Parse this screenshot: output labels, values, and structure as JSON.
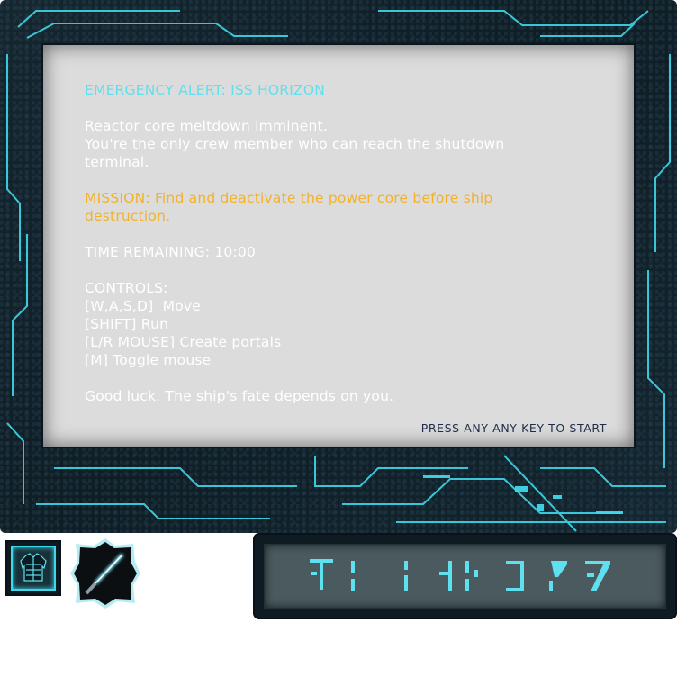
{
  "briefing": {
    "title": "EMERGENCY ALERT: ISS HORIZON",
    "line1": "Reactor core meltdown imminent.",
    "line2": "You're the only crew member who can reach the shutdown",
    "line3": "terminal.",
    "mission_line1": "MISSION: Find and deactivate the power core before ship",
    "mission_line2": "destruction.",
    "time_remaining": "TIME REMAINING: 10:00",
    "controls_header": "CONTROLS:",
    "controls": [
      "[W,A,S,D]  Move",
      "[SHIFT] Run",
      "[L/R MOUSE] Create portals",
      "[M] Toggle mouse"
    ],
    "closing": "Good luck. The ship's fate depends on you.",
    "prompt": "PRESS ANY ANY KEY TO START"
  },
  "inventory": {
    "slot1_icon": "armor-vest-icon",
    "slot2_icon": "lightsaber-icon"
  },
  "hud": {
    "timer_glyph_color": "#5ee0ee"
  },
  "colors": {
    "accent": "#3fd8ea",
    "title": "#5ee0ee",
    "mission": "#f4b12a",
    "prompt": "#1f2d48",
    "screen": "#dcdcdc",
    "frame": "#12222b"
  }
}
